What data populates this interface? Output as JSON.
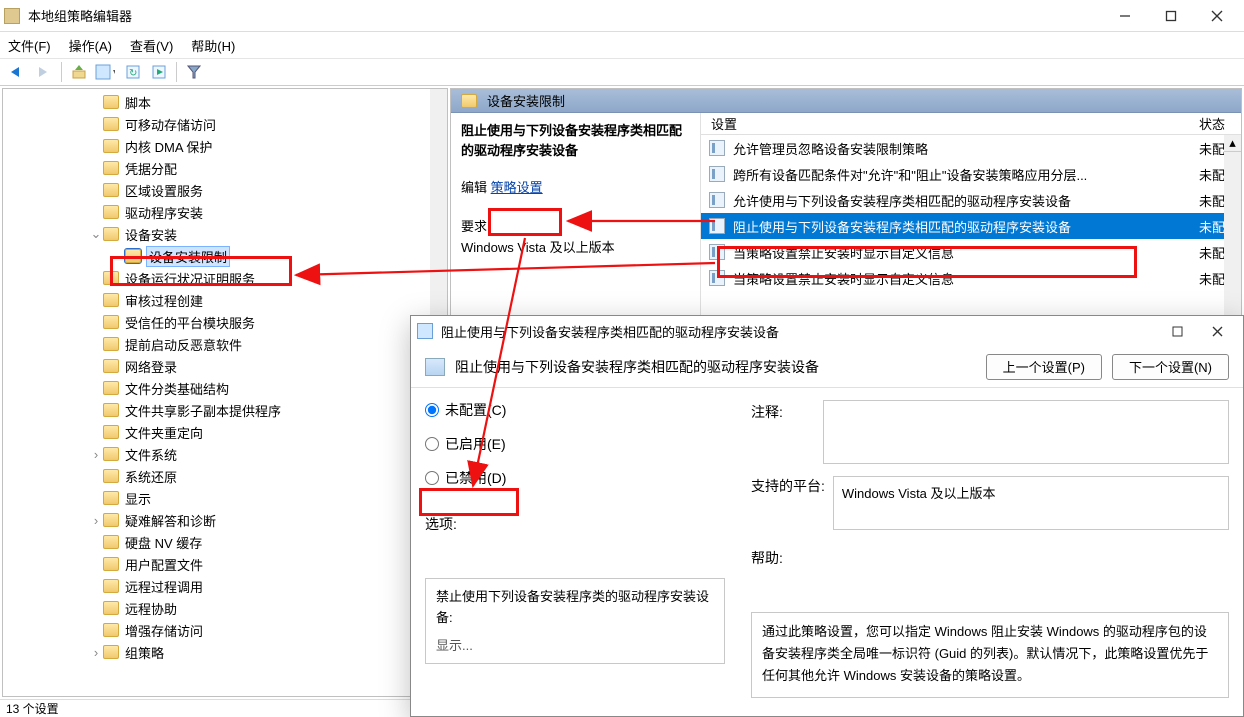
{
  "window": {
    "title": "本地组策略编辑器",
    "menus": {
      "file": "文件(F)",
      "action": "操作(A)",
      "view": "查看(V)",
      "help": "帮助(H)"
    }
  },
  "tree": {
    "items": [
      {
        "label": "脚本",
        "lvl": 1
      },
      {
        "label": "可移动存储访问",
        "lvl": 1
      },
      {
        "label": "内核 DMA 保护",
        "lvl": 1
      },
      {
        "label": "凭据分配",
        "lvl": 1
      },
      {
        "label": "区域设置服务",
        "lvl": 1
      },
      {
        "label": "驱动程序安装",
        "lvl": 1
      },
      {
        "label": "设备安装",
        "lvl": 1,
        "expanded": true
      },
      {
        "label": "设备安装限制",
        "lvl": 2,
        "selected": true
      },
      {
        "label": "设备运行状况证明服务",
        "lvl": 1
      },
      {
        "label": "审核过程创建",
        "lvl": 1
      },
      {
        "label": "受信任的平台模块服务",
        "lvl": 1
      },
      {
        "label": "提前启动反恶意软件",
        "lvl": 1
      },
      {
        "label": "网络登录",
        "lvl": 1
      },
      {
        "label": "文件分类基础结构",
        "lvl": 1
      },
      {
        "label": "文件共享影子副本提供程序",
        "lvl": 1
      },
      {
        "label": "文件夹重定向",
        "lvl": 1
      },
      {
        "label": "文件系统",
        "lvl": 1,
        "expandable": true
      },
      {
        "label": "系统还原",
        "lvl": 1
      },
      {
        "label": "显示",
        "lvl": 1
      },
      {
        "label": "疑难解答和诊断",
        "lvl": 1,
        "expandable": true
      },
      {
        "label": "硬盘 NV 缓存",
        "lvl": 1
      },
      {
        "label": "用户配置文件",
        "lvl": 1
      },
      {
        "label": "远程过程调用",
        "lvl": 1
      },
      {
        "label": "远程协助",
        "lvl": 1
      },
      {
        "label": "增强存储访问",
        "lvl": 1
      },
      {
        "label": "组策略",
        "lvl": 1,
        "expandable": true
      }
    ]
  },
  "right": {
    "header": "设备安装限制",
    "desc_title": "阻止使用与下列设备安装程序类相匹配的驱动程序安装设备",
    "edit_label": "编辑",
    "edit_link": "策略设置",
    "req_label": "要求:",
    "req_value": "Windows Vista 及以上版本",
    "col_setting": "设置",
    "col_state": "状态",
    "rows": [
      {
        "label": "允许管理员忽略设备安装限制策略",
        "state": "未配置"
      },
      {
        "label": "跨所有设备匹配条件对\"允许\"和\"阻止\"设备安装策略应用分层...",
        "state": "未配置"
      },
      {
        "label": "允许使用与下列设备安装程序类相匹配的驱动程序安装设备",
        "state": "未配置"
      },
      {
        "label": "阻止使用与下列设备安装程序类相匹配的驱动程序安装设备",
        "state": "未配置",
        "selected": true
      },
      {
        "label": "当策略设置禁止安装时显示自定义信息",
        "state": "未配置"
      },
      {
        "label": "当策略设置禁止安装时显示自定义信息",
        "state": "未配置"
      }
    ]
  },
  "status": "13 个设置",
  "dialog": {
    "title": "阻止使用与下列设备安装程序类相匹配的驱动程序安装设备",
    "heading": "阻止使用与下列设备安装程序类相匹配的驱动程序安装设备",
    "prev": "上一个设置(P)",
    "next": "下一个设置(N)",
    "radio_notconf": "未配置(C)",
    "radio_enabled": "已启用(E)",
    "radio_disabled": "已禁用(D)",
    "comment_label": "注释:",
    "platform_label": "支持的平台:",
    "platform_value": "Windows Vista 及以上版本",
    "options_label": "选项:",
    "help_label": "帮助:",
    "options_text": "禁止使用下列设备安装程序类的驱动程序安装设备:",
    "options_show": "显示...",
    "help_text": "通过此策略设置，您可以指定 Windows 阻止安装 Windows 的驱动程序包的设备安装程序类全局唯一标识符 (Guid 的列表)。默认情况下，此策略设置优先于任何其他允许 Windows 安装设备的策略设置。"
  }
}
